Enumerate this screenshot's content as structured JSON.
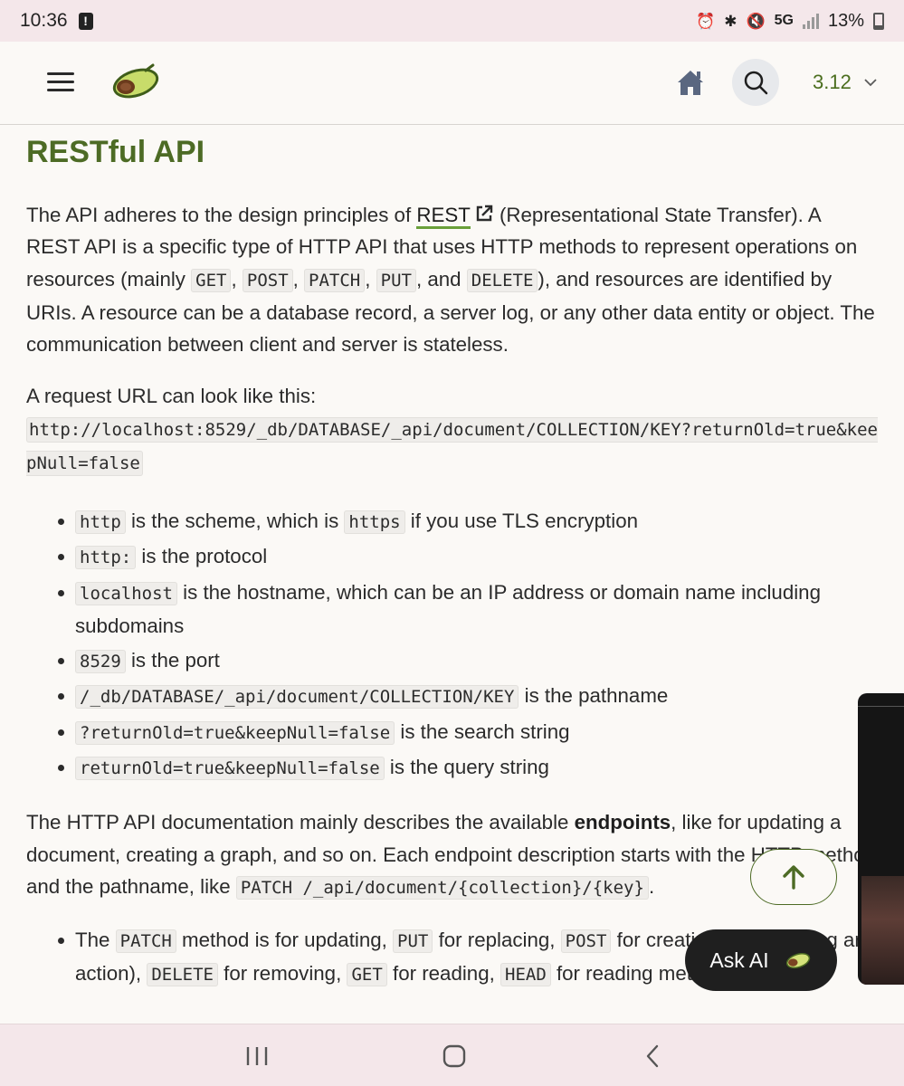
{
  "status_bar": {
    "time": "10:36",
    "network": "5G",
    "battery": "13%"
  },
  "header": {
    "version": "3.12",
    "icons": [
      "menu-icon",
      "avocado-logo",
      "home-icon",
      "search-icon",
      "chevron-down-icon"
    ]
  },
  "content": {
    "title": "RESTful API",
    "intro": {
      "before_link": "The API adheres to the design principles of ",
      "link": "REST",
      "after_link": " (Representational State Transfer). A REST API is a specific type of HTTP API that uses HTTP methods to represent operations on resources (mainly ",
      "methods": [
        "GET",
        "POST",
        "PATCH",
        "PUT",
        "DELETE"
      ],
      "sep": ", ",
      "and": ", and ",
      "after_methods": "), and resources are identified by URIs. A resource can be a database record, a server log, or any other data entity or object. The communication between client and server is stateless."
    },
    "url_intro": "A request URL can look like this:",
    "url_example": "http://localhost:8529/_db/DATABASE/_api/document/COLLECTION/KEY?returnOld=true&keepNull=false",
    "url_parts": [
      {
        "code": "http",
        "text": " is the scheme, which is ",
        "code2": "https",
        "text2": " if you use TLS encryption"
      },
      {
        "code": "http:",
        "text": " is the protocol"
      },
      {
        "code": "localhost",
        "text": " is the hostname, which can be an IP address or domain name including subdomains"
      },
      {
        "code": "8529",
        "text": " is the port"
      },
      {
        "code": "/_db/DATABASE/_api/document/COLLECTION/KEY",
        "text": " is the pathname"
      },
      {
        "code": "?returnOld=true&keepNull=false",
        "text": " is the search string"
      },
      {
        "code": "returnOld=true&keepNull=false",
        "text": " is the query string"
      }
    ],
    "endpoints": {
      "before_bold": "The HTTP API documentation mainly describes the available ",
      "bold": "endpoints",
      "after_bold": ", like for updating a document, creating a graph, and so on. Each endpoint description starts with the HTTP method and the pathname, like ",
      "code": "PATCH /_api/document/{collection}/{key}",
      "end": "."
    },
    "methods_list": {
      "t1": "The ",
      "c1": "PATCH",
      "t2": " method is for updating, ",
      "c2": "PUT",
      "t3": " for replacing, ",
      "c3": "POST",
      "t4": " for creating (or triggering an action), ",
      "c4": "DELETE",
      "t5": " for removing, ",
      "c5": "GET",
      "t6": " for reading, ",
      "c6": "HEAD",
      "t7": " for reading metadata only"
    }
  },
  "floating": {
    "scroll_top_icon": "arrow-up-icon",
    "ask_ai_label": "Ask AI"
  },
  "nav_bar": {
    "icons": [
      "recent-apps-icon",
      "home-nav-icon",
      "back-icon"
    ]
  },
  "colors": {
    "accent": "#4d6b25",
    "link_underline": "#6aa03a",
    "status_bar_bg": "#f4e7ea",
    "page_bg": "#fbf9f6"
  }
}
